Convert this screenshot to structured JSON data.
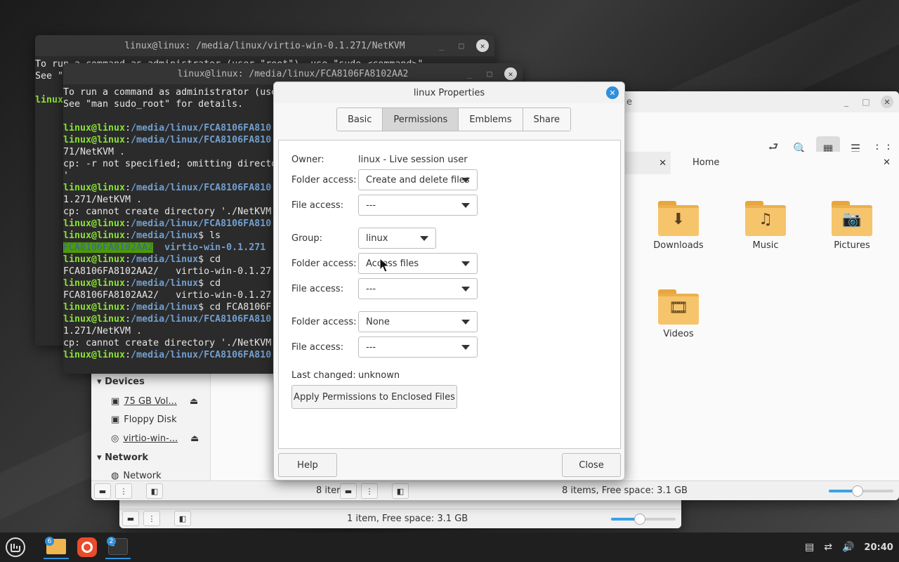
{
  "terminal_back": {
    "title": "linux@linux: /media/linux/virtio-win-0.1.271/NetKVM",
    "lines": [
      "To run a command as administrator (user \"root\"), use \"sudo <command>\".",
      "See \"man sudo_root\" for details.",
      "",
      "linux"
    ]
  },
  "terminal_front": {
    "title": "linux@linux: /media/linux/FCA8106FA8102AA2",
    "line1": "To run a command as administrator (use",
    "line2": "See \"man sudo_root\" for details.",
    "prompt_user": "linux@linux",
    "path_fca": "/media/linux/FCA8106FA810",
    "path_media": "/media/linux",
    "out_netkvm": "71/NetKVM .",
    "out_omit": "cp: -r not specified; omitting directo",
    "out_quote": "'",
    "out_netkvm2": "1.271/NetKVM .",
    "out_cannot": "cp: cannot create directory './NetKVM",
    "cmd_ls": "$ ls",
    "ls_dir1": "FCA8106FA8102AA2",
    "ls_dir2": "virtio-win-0.1.271",
    "cmd_cd": "$ cd",
    "cd_out": "FCA8106FA8102AA2/   virtio-win-0.1.27",
    "cmd_cd2": "$ cd FCA8106F"
  },
  "file_manager": {
    "title": "e",
    "tab_home": "Home",
    "folders": [
      {
        "name": "Downloads",
        "icon": "download-icon"
      },
      {
        "name": "Music",
        "icon": "music-icon"
      },
      {
        "name": "Pictures",
        "icon": "camera-icon"
      },
      {
        "name": "Videos",
        "icon": "film-icon"
      }
    ],
    "status_left": "8 iter",
    "status": "8 items, Free space: 3.1 GB",
    "zoom_level": 0.45
  },
  "sidebar": {
    "devices_header": "Devices",
    "devices": [
      "75 GB Vol...",
      "Floppy Disk",
      "virtio-win-..."
    ],
    "network_header": "Network",
    "network_item": "Network"
  },
  "file_manager_back": {
    "status": "1 item, Free space: 3.1 GB",
    "zoom_level": 0.45
  },
  "dialog": {
    "title": "linux Properties",
    "tabs": [
      "Basic",
      "Permissions",
      "Emblems",
      "Share"
    ],
    "owner_label": "Owner:",
    "owner_value": "linux - Live session user",
    "folder_access_label": "Folder access:",
    "file_access_label": "File access:",
    "owner_folder_access": "Create and delete files",
    "owner_file_access": "---",
    "group_label": "Group:",
    "group_value": "linux",
    "group_folder_access": "Access files",
    "group_file_access": "---",
    "others_folder_access": "None",
    "others_file_access": "---",
    "last_changed_label": "Last changed:",
    "last_changed_value": "unknown",
    "apply_button": "Apply Permissions to Enclosed Files",
    "help_button": "Help",
    "close_button": "Close"
  },
  "taskbar": {
    "files_badge": "6",
    "terminal_badge": "2",
    "clock": "20:40"
  },
  "colors": {
    "accent": "#2f8fdb",
    "prompt_green": "#8ae234",
    "path_blue": "#729fcf"
  }
}
